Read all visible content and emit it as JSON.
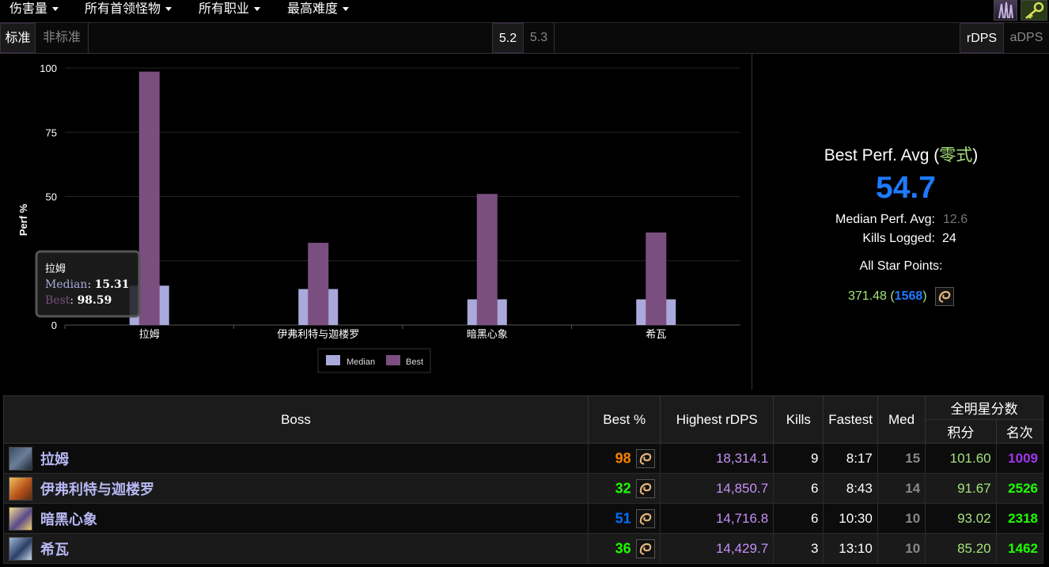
{
  "menus": [
    "伤害量",
    "所有首领怪物",
    "所有职业",
    "最高难度"
  ],
  "toggles": {
    "standard": "标准",
    "nonstandard": "非标准",
    "v52": "5.2",
    "v53": "5.3",
    "rdps": "rDPS",
    "adps": "aDPS"
  },
  "chart": {
    "yaxis_label": "Perf %",
    "legend_median": "Median",
    "legend_best": "Best",
    "tooltip": {
      "boss": "拉姆",
      "median_label": "Median",
      "median_value": "15.31",
      "best_label": "Best",
      "best_value": "98.59"
    }
  },
  "chart_data": {
    "type": "bar",
    "categories": [
      "拉姆",
      "伊弗利特与迦楼罗",
      "暗黑心象",
      "希瓦"
    ],
    "series": [
      {
        "name": "Median",
        "values": [
          15.31,
          14,
          10,
          10
        ],
        "color": "#a9a9db"
      },
      {
        "name": "Best",
        "values": [
          98.59,
          32,
          51,
          36
        ],
        "color": "#7a4f7f"
      }
    ],
    "yticks": [
      0,
      25,
      50,
      75,
      100
    ],
    "ytick_labels": [
      "0",
      "",
      "50",
      "75",
      "100"
    ],
    "ylim": [
      0,
      100
    ],
    "ylabel": "Perf %",
    "grid": true,
    "legend": "bottom"
  },
  "summary": {
    "title_prefix": "Best Perf. Avg (",
    "difficulty": "零式",
    "title_suffix": ")",
    "value": "54.7",
    "median_label": "Median Perf. Avg:",
    "median_value": "12.6",
    "kills_label": "Kills Logged:",
    "kills_value": "24",
    "star_label": "All Star Points:",
    "star_points": "371.48",
    "star_rank": "1568"
  },
  "table": {
    "headers": {
      "boss": "Boss",
      "best": "Best %",
      "highest": "Highest rDPS",
      "kills": "Kills",
      "fastest": "Fastest",
      "med": "Med",
      "allstar": "全明星分数",
      "points": "积分",
      "rank": "名次"
    },
    "rows": [
      {
        "boss": "拉姆",
        "best": "98",
        "best_color": "#ff8000",
        "highest": "18,314.1",
        "kills": "9",
        "fastest": "8:17",
        "med": "15",
        "points": "101.60",
        "rank": "1009",
        "rank_color": "#a335ee",
        "icon": "ramuh-icon"
      },
      {
        "boss": "伊弗利特与迦楼罗",
        "best": "32",
        "best_color": "#1eff00",
        "highest": "14,850.7",
        "kills": "6",
        "fastest": "8:43",
        "med": "14",
        "points": "91.67",
        "rank": "2526",
        "rank_color": "#1eff00",
        "icon": "ifrit-garuda-icon"
      },
      {
        "boss": "暗黑心象",
        "best": "51",
        "best_color": "#0070ff",
        "highest": "14,716.8",
        "kills": "6",
        "fastest": "10:30",
        "med": "10",
        "points": "93.02",
        "rank": "2318",
        "rank_color": "#1eff00",
        "icon": "idol-of-darkness-icon"
      },
      {
        "boss": "希瓦",
        "best": "36",
        "best_color": "#1eff00",
        "highest": "14,429.7",
        "kills": "3",
        "fastest": "13:10",
        "med": "10",
        "points": "85.20",
        "rank": "1462",
        "rank_color": "#1eff00",
        "icon": "shiva-icon"
      }
    ]
  }
}
